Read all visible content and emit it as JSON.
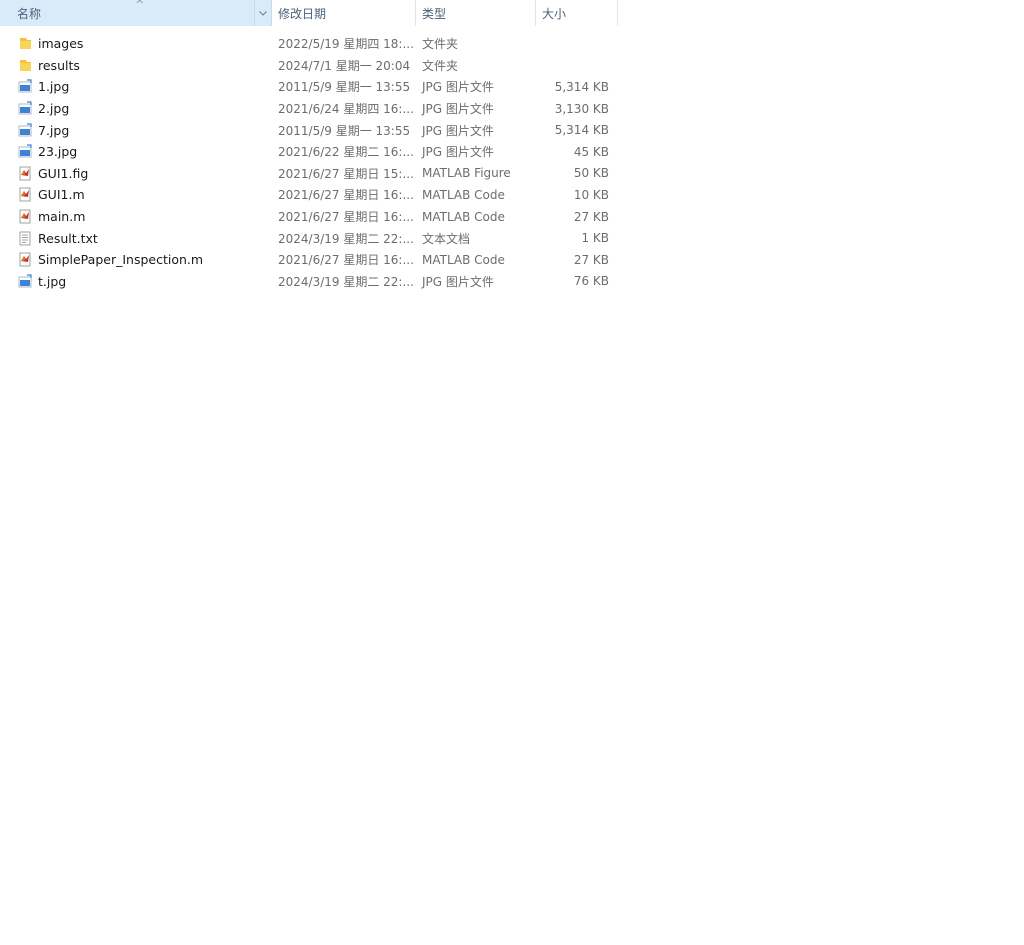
{
  "header": {
    "name": "名称",
    "date": "修改日期",
    "type": "类型",
    "size": "大小",
    "sort_arrow": "^",
    "dropdown_arrow": "v"
  },
  "files": [
    {
      "name": "images",
      "date": "2022/5/19 星期四 18:...",
      "type": "文件夹",
      "size": "",
      "icon": "folder-icon"
    },
    {
      "name": "results",
      "date": "2024/7/1 星期一 20:04",
      "type": "文件夹",
      "size": "",
      "icon": "folder-icon"
    },
    {
      "name": "1.jpg",
      "date": "2011/5/9 星期一 13:55",
      "type": "JPG 图片文件",
      "size": "5,314 KB",
      "icon": "image-file-icon"
    },
    {
      "name": "2.jpg",
      "date": "2021/6/24 星期四 16:...",
      "type": "JPG 图片文件",
      "size": "3,130 KB",
      "icon": "image-file-icon"
    },
    {
      "name": "7.jpg",
      "date": "2011/5/9 星期一 13:55",
      "type": "JPG 图片文件",
      "size": "5,314 KB",
      "icon": "image-file-icon"
    },
    {
      "name": "23.jpg",
      "date": "2021/6/22 星期二 16:...",
      "type": "JPG 图片文件",
      "size": "45 KB",
      "icon": "image-file-icon"
    },
    {
      "name": "GUI1.fig",
      "date": "2021/6/27 星期日 15:...",
      "type": "MATLAB Figure",
      "size": "50 KB",
      "icon": "matlab-file-icon"
    },
    {
      "name": "GUI1.m",
      "date": "2021/6/27 星期日 16:...",
      "type": "MATLAB Code",
      "size": "10 KB",
      "icon": "matlab-file-icon"
    },
    {
      "name": "main.m",
      "date": "2021/6/27 星期日 16:...",
      "type": "MATLAB Code",
      "size": "27 KB",
      "icon": "matlab-file-icon"
    },
    {
      "name": "Result.txt",
      "date": "2024/3/19 星期二 22:...",
      "type": "文本文档",
      "size": "1 KB",
      "icon": "text-file-icon"
    },
    {
      "name": "SimplePaper_Inspection.m",
      "date": "2021/6/27 星期日 16:...",
      "type": "MATLAB Code",
      "size": "27 KB",
      "icon": "matlab-file-icon"
    },
    {
      "name": "t.jpg",
      "date": "2024/3/19 星期二 22:...",
      "type": "JPG 图片文件",
      "size": "76 KB",
      "icon": "image-file-icon"
    }
  ],
  "colors": {
    "header_selected_bg": "#d9ebf9",
    "header_text": "#4c607a",
    "folder": "#f3c13a",
    "image_icon": "#3c83d6",
    "matlab_icon": "#c0392b"
  }
}
